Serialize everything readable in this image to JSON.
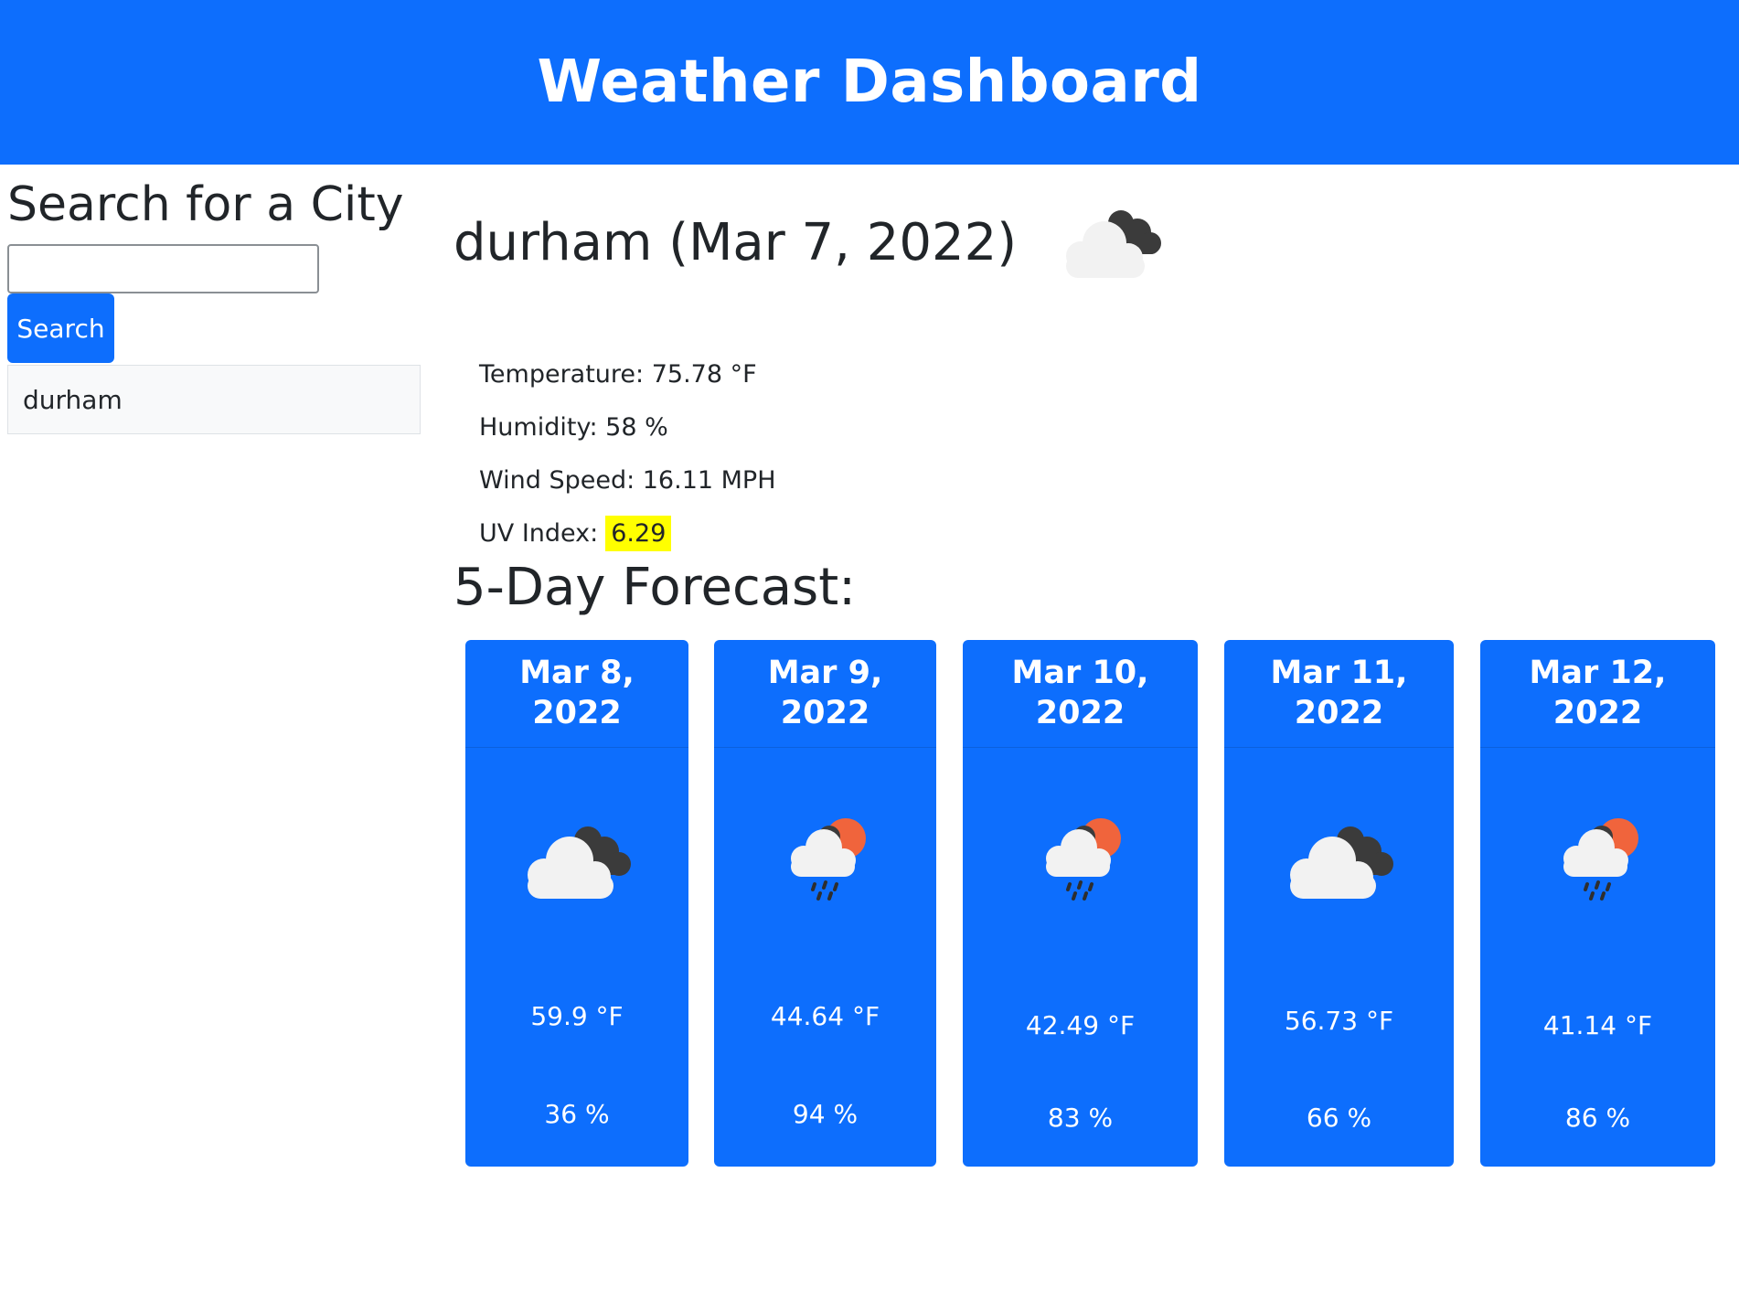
{
  "header": {
    "title": "Weather Dashboard"
  },
  "sidebar": {
    "title": "Search for a City",
    "search_value": "",
    "search_button_label": "Search",
    "history": [
      "durham"
    ]
  },
  "current": {
    "title": "durham (Mar 7, 2022)",
    "icon": "partly-cloudy-dark-icon",
    "temperature": "Temperature: 75.78 °F",
    "humidity": "Humidity: 58 %",
    "wind": "Wind Speed: 16.11 MPH",
    "uv_label": "UV Index:",
    "uv_value": "6.29",
    "uv_color": "#ffff00"
  },
  "forecast": {
    "title": "5-Day Forecast:",
    "days": [
      {
        "date": "Mar 8, 2022",
        "icon": "cloudy-icon",
        "temp": "59.9 °F",
        "humidity": "36 %"
      },
      {
        "date": "Mar 9, 2022",
        "icon": "rain-sun-icon",
        "temp": "44.64 °F",
        "humidity": "94 %"
      },
      {
        "date": "Mar 10, 2022",
        "icon": "rain-sun-icon",
        "temp": "42.49 °F",
        "humidity": "83 %"
      },
      {
        "date": "Mar 11, 2022",
        "icon": "cloudy-icon",
        "temp": "56.73 °F",
        "humidity": "66 %"
      },
      {
        "date": "Mar 12, 2022",
        "icon": "rain-sun-icon",
        "temp": "41.14 °F",
        "humidity": "86 %"
      }
    ]
  },
  "colors": {
    "primary": "#0d6efd",
    "uv_highlight": "#ffff00"
  }
}
